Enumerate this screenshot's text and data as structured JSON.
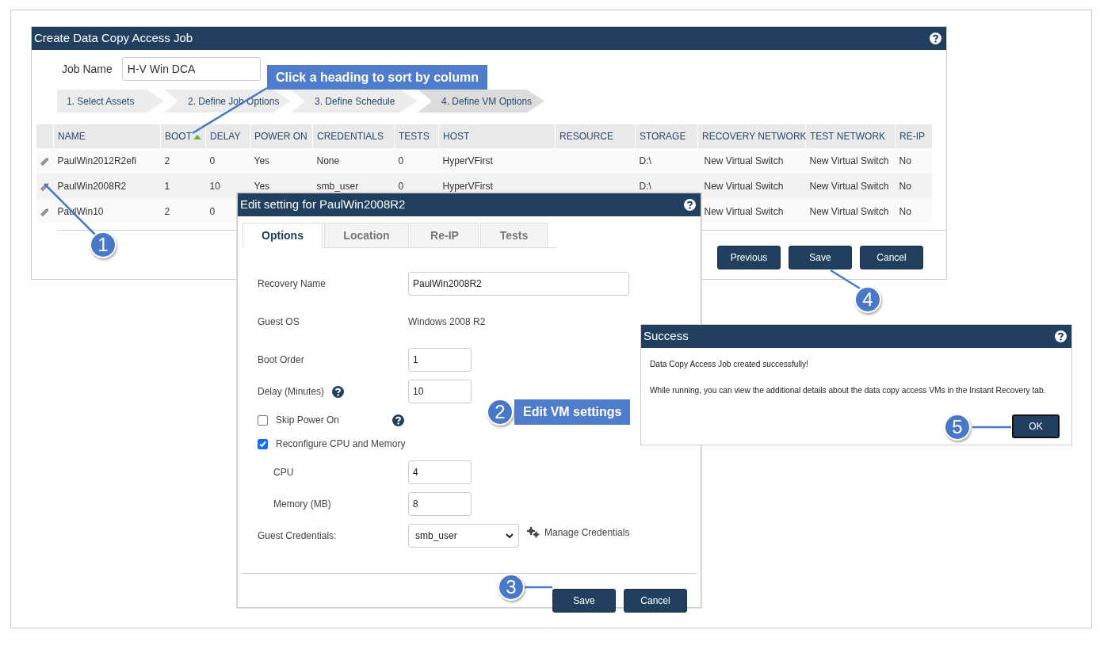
{
  "main_window": {
    "title": "Create Data Copy Access Job",
    "job_name": {
      "label": "Job Name",
      "value": "H-V Win DCA"
    },
    "steps": [
      {
        "label": "1. Select Assets",
        "selected": false
      },
      {
        "label": "2. Define Job Options",
        "selected": false
      },
      {
        "label": "3. Define Schedule",
        "selected": false
      },
      {
        "label": "4. Define VM Options",
        "selected": true
      }
    ],
    "table": {
      "columns": [
        {
          "label": "NAME",
          "sorted": false
        },
        {
          "label": "BOOT",
          "sorted": true
        },
        {
          "label": "DELAY",
          "sorted": false
        },
        {
          "label": "POWER ON",
          "sorted": false
        },
        {
          "label": "CREDENTIALS",
          "sorted": false
        },
        {
          "label": "TESTS",
          "sorted": false
        },
        {
          "label": "HOST",
          "sorted": false
        },
        {
          "label": "RESOURCE",
          "sorted": false
        },
        {
          "label": "STORAGE",
          "sorted": false
        },
        {
          "label": "RECOVERY NETWORK",
          "sorted": false
        },
        {
          "label": "TEST NETWORK",
          "sorted": false
        },
        {
          "label": "RE-IP",
          "sorted": false
        }
      ],
      "rows": [
        {
          "cells": [
            "PaulWin2012R2efi",
            "2",
            "0",
            "Yes",
            "None",
            "0",
            "HyperVFirst",
            null,
            "D:\\",
            "New Virtual Switch",
            "New Virtual Switch",
            "No"
          ]
        },
        {
          "cells": [
            "PaulWin2008R2",
            "1",
            "10",
            "Yes",
            "smb_user",
            "0",
            "HyperVFirst",
            null,
            "D:\\",
            "New Virtual Switch",
            "New Virtual Switch",
            "No"
          ]
        },
        {
          "cells": [
            "PaulWin10",
            "2",
            "0",
            null,
            null,
            null,
            null,
            null,
            null,
            "New Virtual Switch",
            "New Virtual Switch",
            "No"
          ]
        }
      ]
    },
    "buttons": [
      "Previous",
      "Save",
      "Cancel"
    ]
  },
  "edit_dialog": {
    "title": "Edit setting for PaulWin2008R2",
    "tabs": [
      {
        "label": "Options",
        "selected": true
      },
      {
        "label": "Location",
        "selected": false
      },
      {
        "label": "Re-IP",
        "selected": false
      },
      {
        "label": "Tests",
        "selected": false
      }
    ],
    "fields": [
      {
        "kind": "text",
        "label": "Recovery Name",
        "value": "PaulWin2008R2"
      },
      {
        "kind": "static",
        "label": "Guest OS",
        "value": "Windows 2008 R2"
      },
      {
        "kind": "number",
        "label": "Boot Order",
        "value": "1"
      },
      {
        "kind": "number",
        "label": "Delay (Minutes)",
        "value": "10",
        "help": true
      },
      {
        "kind": "checkbox",
        "label": "Skip Power On",
        "checked": false,
        "help": true
      },
      {
        "kind": "checkbox",
        "label": "Reconfigure CPU and Memory",
        "checked": true
      },
      {
        "kind": "number",
        "label": "CPU",
        "value": "4",
        "indent": true
      },
      {
        "kind": "number",
        "label": "Memory (MB)",
        "value": "8",
        "indent": true
      },
      {
        "kind": "select",
        "label": "Guest Credentials:",
        "value": "smb_user",
        "link": "Manage Credentials"
      }
    ],
    "buttons": [
      "Save",
      "Cancel"
    ]
  },
  "success_dialog": {
    "title": "Success",
    "messages": [
      "Data Copy Access Job created successfully!",
      "While running, you can view the additional details about the data copy access VMs in the Instant Recovery tab."
    ],
    "buttons": [
      "OK"
    ]
  },
  "annotations": [
    {
      "kind": "label",
      "text": "Click a heading to sort by column"
    },
    {
      "kind": "step",
      "number": "1"
    },
    {
      "kind": "step",
      "number": "2",
      "text": "Edit VM settings"
    },
    {
      "kind": "step",
      "number": "3"
    },
    {
      "kind": "step",
      "number": "4"
    },
    {
      "kind": "step",
      "number": "5"
    }
  ]
}
